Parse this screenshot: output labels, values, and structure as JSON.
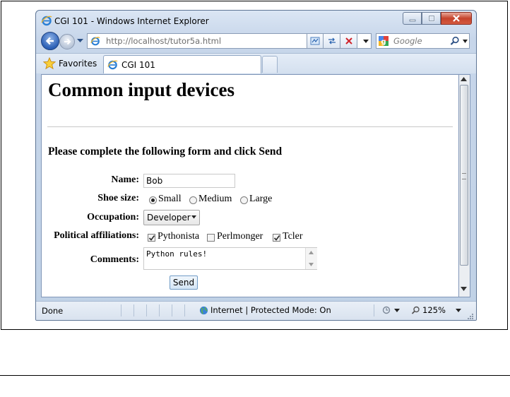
{
  "window": {
    "title": "CGI 101 - Windows Internet Explorer"
  },
  "address_bar": {
    "url": "http://localhost/tutor5a.html"
  },
  "search": {
    "placeholder": "Google"
  },
  "tabs": {
    "favorites_label": "Favorites",
    "active_tab_label": "CGI 101"
  },
  "page": {
    "title": "Common input devices",
    "form_heading": "Please complete the following form and click Send",
    "form": {
      "name_label": "Name:",
      "name_value": "Bob",
      "shoe_size_label": "Shoe size:",
      "shoe_options": [
        "Small",
        "Medium",
        "Large"
      ],
      "shoe_selected": "Small",
      "occupation_label": "Occupation:",
      "occupation_value": "Developer",
      "political_label": "Political affiliations:",
      "political_options": [
        {
          "label": "Pythonista",
          "checked": true
        },
        {
          "label": "Perlmonger",
          "checked": false
        },
        {
          "label": "Tcler",
          "checked": true
        }
      ],
      "comments_label": "Comments:",
      "comments_value": "Python rules!",
      "send_label": "Send"
    }
  },
  "status_bar": {
    "left_text": "Done",
    "zone_text": "Internet | Protected Mode: On",
    "zoom_text": "125%"
  },
  "colors": {
    "ie_blue": "#2b5fb5",
    "close_red": "#c5432c",
    "chrome_bg": "#c7d6ea"
  }
}
